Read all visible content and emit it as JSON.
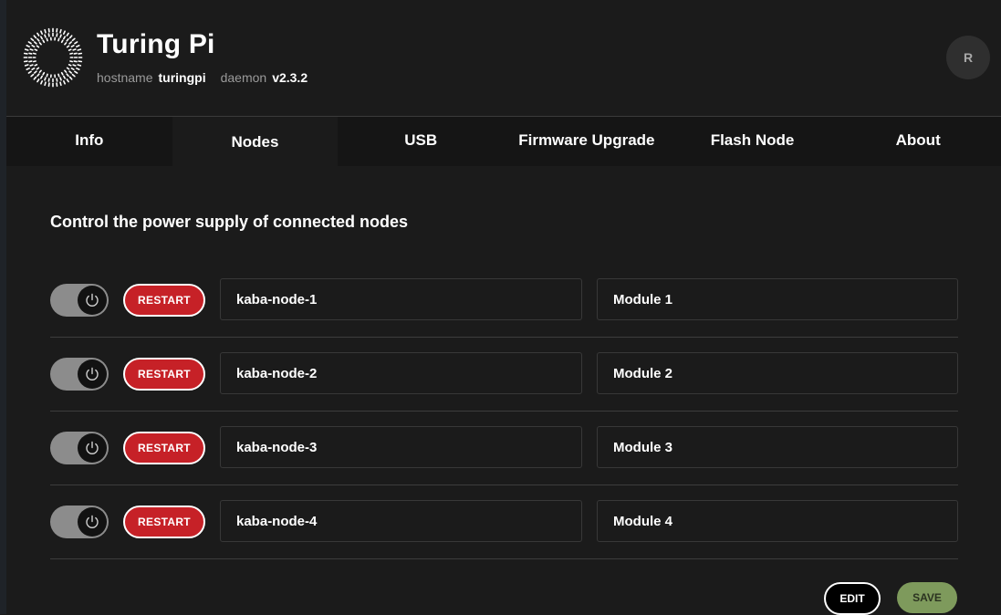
{
  "header": {
    "title": "Turing Pi",
    "hostname_label": "hostname",
    "hostname_value": "turingpi",
    "daemon_label": "daemon",
    "daemon_value": "v2.3.2",
    "avatar_initial": "R",
    "logo_icon": "turing-pi-logo-icon"
  },
  "tabs": [
    {
      "label": "Info",
      "active": false
    },
    {
      "label": "Nodes",
      "active": true
    },
    {
      "label": "USB",
      "active": false
    },
    {
      "label": "Firmware Upgrade",
      "active": false
    },
    {
      "label": "Flash Node",
      "active": false
    },
    {
      "label": "About",
      "active": false
    }
  ],
  "nodes_panel": {
    "heading": "Control the power supply of connected nodes",
    "restart_label": "RESTART",
    "power_icon": "power-icon",
    "rows": [
      {
        "power_on": true,
        "name": "kaba-node-1",
        "module": "Module 1"
      },
      {
        "power_on": true,
        "name": "kaba-node-2",
        "module": "Module 2"
      },
      {
        "power_on": true,
        "name": "kaba-node-3",
        "module": "Module 3"
      },
      {
        "power_on": true,
        "name": "kaba-node-4",
        "module": "Module 4"
      }
    ],
    "edit_label": "EDIT",
    "save_label": "SAVE"
  },
  "colors": {
    "background": "#1b1b1b",
    "tab_bar": "#151515",
    "restart": "#c62127",
    "save": "#7e9a5c",
    "toggle_track": "#8c8c8c"
  }
}
